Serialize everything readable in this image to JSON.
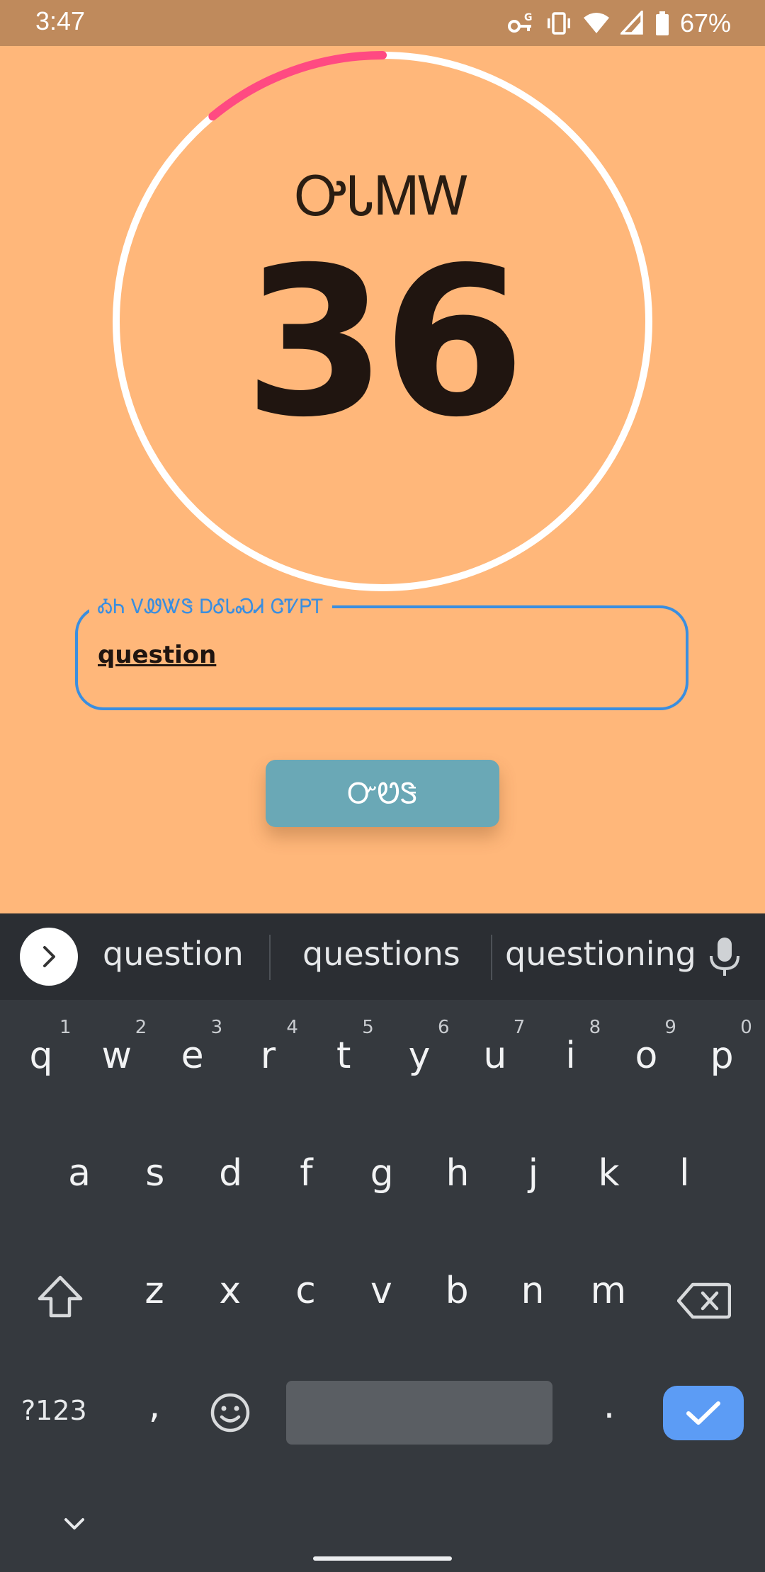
{
  "status_bar": {
    "time": "3:47",
    "battery": "67%",
    "icons": [
      "vpn-key-icon",
      "vibrate-icon",
      "wifi-icon",
      "cell-signal-icon",
      "battery-icon"
    ]
  },
  "timer": {
    "label": "ᎤᏓᎷᎳ",
    "value": "36",
    "progress_fraction": 0.11,
    "colors": {
      "track": "#FFFFFF",
      "progress": "#FF4A82"
    }
  },
  "answer_field": {
    "label": "ᎣᏂ ᏙᏪᏔᏕ ᎠᎴᏓᏍᏗ ᏣᏤᏢᎢ",
    "value": "question"
  },
  "submit_button": {
    "label": "ᏅᏬᏕ"
  },
  "keyboard": {
    "suggestions": [
      "question",
      "questions",
      "questioning"
    ],
    "rows": {
      "row1": [
        "q",
        "w",
        "e",
        "r",
        "t",
        "y",
        "u",
        "i",
        "o",
        "p"
      ],
      "row1_hints": [
        "1",
        "2",
        "3",
        "4",
        "5",
        "6",
        "7",
        "8",
        "9",
        "0"
      ],
      "row2": [
        "a",
        "s",
        "d",
        "f",
        "g",
        "h",
        "j",
        "k",
        "l"
      ],
      "row3": [
        "z",
        "x",
        "c",
        "v",
        "b",
        "n",
        "m"
      ]
    },
    "symbols_label": "?123",
    "comma": ",",
    "period": "."
  },
  "colors": {
    "background": "#FFB77A",
    "status_bar": "#BF8A5C",
    "input_border": "#3A8EE0",
    "button": "#6AA8B6",
    "keyboard": "#35393E",
    "enter_key": "#5C9CF5"
  }
}
